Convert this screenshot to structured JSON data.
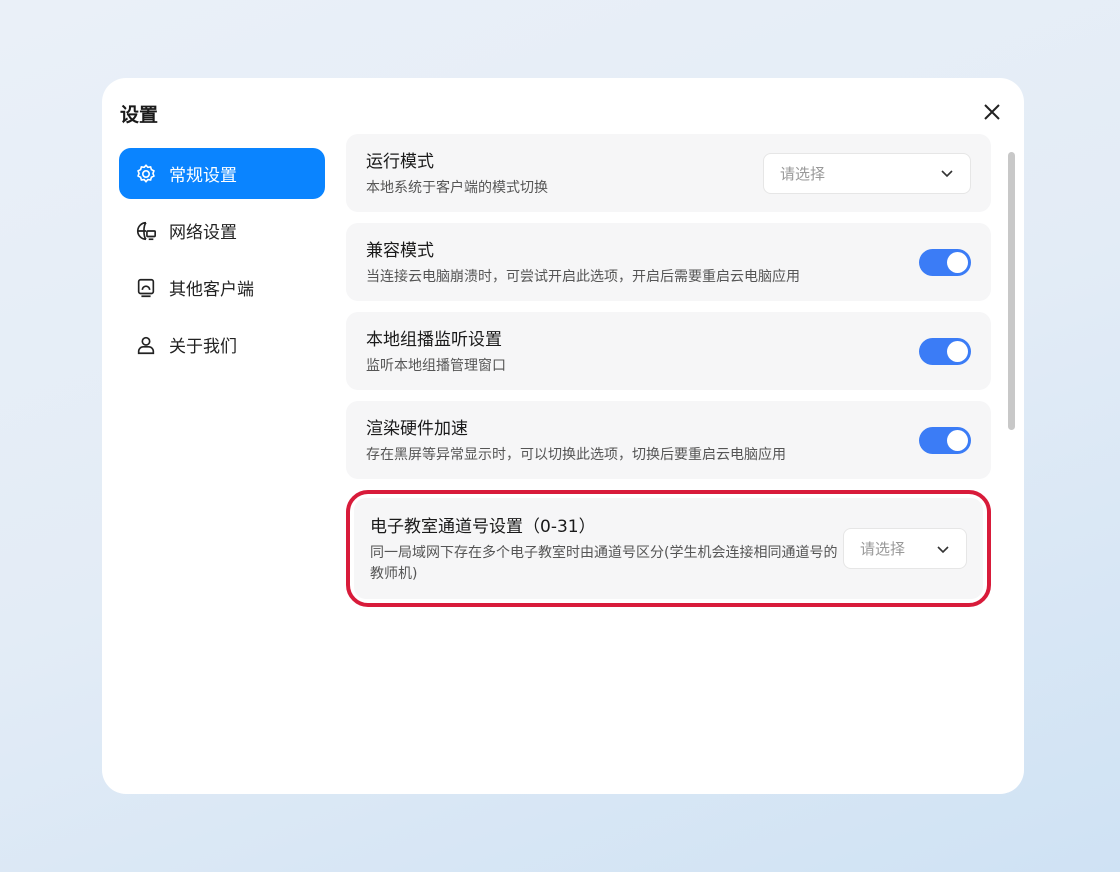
{
  "title": "设置",
  "nav": [
    {
      "label": "常规设置",
      "icon": "gear-icon",
      "active": true
    },
    {
      "label": "网络设置",
      "icon": "globe-monitor-icon"
    },
    {
      "label": "其他客户端",
      "icon": "device-icon"
    },
    {
      "label": "关于我们",
      "icon": "user-icon"
    }
  ],
  "rows": [
    {
      "title": "运行模式",
      "desc": "本地系统于客户端的模式切换",
      "control": "select",
      "placeholder": "请选择"
    },
    {
      "title": "兼容模式",
      "desc": "当连接云电脑崩溃时，可尝试开启此选项，开启后需要重启云电脑应用",
      "control": "toggle",
      "on": true
    },
    {
      "title": "本地组播监听设置",
      "desc": "监听本地组播管理窗口",
      "control": "toggle",
      "on": true
    },
    {
      "title": "渲染硬件加速",
      "desc": "存在黑屏等异常显示时，可以切换此选项，切换后要重启云电脑应用",
      "control": "toggle",
      "on": true
    },
    {
      "title": "电子教室通道号设置（0-31）",
      "desc": "同一局域网下存在多个电子教室时由通道号区分(学生机会连接相同通道号的教师机)",
      "control": "select",
      "placeholder": "请选择"
    }
  ],
  "colors": {
    "accent": "#0a84ff",
    "toggle": "#3b7cf6",
    "highlight": "#d81b3a"
  }
}
